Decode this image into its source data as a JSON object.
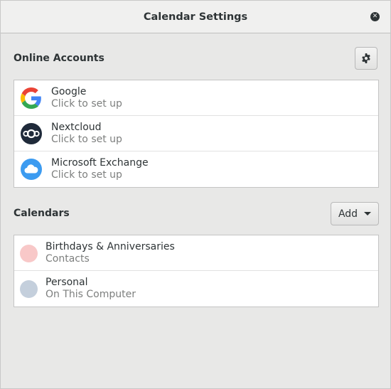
{
  "window": {
    "title": "Calendar Settings"
  },
  "online_accounts": {
    "heading": "Online Accounts",
    "accounts": [
      {
        "name": "Google",
        "subtitle": "Click to set up",
        "icon": "google-icon"
      },
      {
        "name": "Nextcloud",
        "subtitle": "Click to set up",
        "icon": "nextcloud-icon"
      },
      {
        "name": "Microsoft Exchange",
        "subtitle": "Click to set up",
        "icon": "exchange-cloud-icon"
      }
    ]
  },
  "calendars": {
    "heading": "Calendars",
    "add_label": "Add",
    "items": [
      {
        "name": "Birthdays & Anniversaries",
        "source": "Contacts",
        "color": "#f8c8c8"
      },
      {
        "name": "Personal",
        "source": "On This Computer",
        "color": "#c4cfdc"
      }
    ]
  },
  "colors": {
    "nextcloud": "#1f2a3a",
    "exchange": "#3c9bf0"
  }
}
